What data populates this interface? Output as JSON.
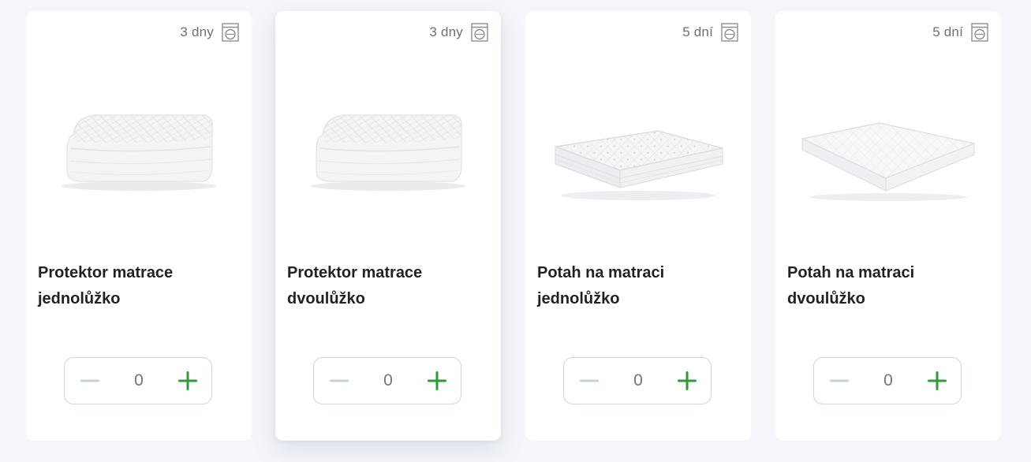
{
  "products": [
    {
      "title_line1": "Protektor matrace",
      "title_line2": "jednolůžko",
      "wash_time": "3 dny",
      "quantity": "0",
      "image": "mattress-protector-image",
      "highlighted": false
    },
    {
      "title_line1": "Protektor matrace",
      "title_line2": "dvoulůžko",
      "wash_time": "3 dny",
      "quantity": "0",
      "image": "mattress-protector-image",
      "highlighted": true
    },
    {
      "title_line1": "Potah na matraci",
      "title_line2": "jednolůžko",
      "wash_time": "5 dní",
      "quantity": "0",
      "image": "mattress-image",
      "highlighted": false
    },
    {
      "title_line1": "Potah na matraci",
      "title_line2": "dvoulůžko",
      "wash_time": "5 dní",
      "quantity": "0",
      "image": "mattress-image",
      "highlighted": false
    }
  ],
  "icons": {
    "wash": "washing-machine-icon",
    "decrement": "minus-icon",
    "increment": "plus-icon"
  },
  "colors": {
    "background": "#f4f6fb",
    "card": "#ffffff",
    "plus": "#2e9a38",
    "minus": "#c4d2dd",
    "title": "#1e2227",
    "muted": "#6b6f78"
  }
}
